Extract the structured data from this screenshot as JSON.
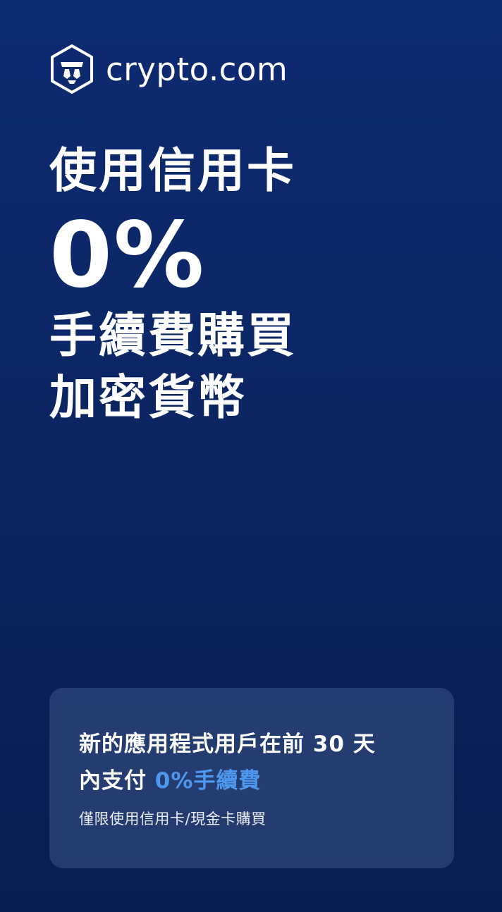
{
  "brand": {
    "name": "crypto.com",
    "icon": "crypto-com-lion-shield-icon"
  },
  "headline": {
    "line1": "使用信用卡",
    "big": "0%",
    "line2": "手續費購買",
    "line3": "加密貨幣"
  },
  "promo": {
    "title_line1": "新的應用程式用戶在前 30 天",
    "title_line2_prefix": "內支付 ",
    "title_highlight": "0%手續費",
    "note": "僅限使用信用卡/現金卡購買"
  },
  "colors": {
    "background_top": "#0d2b72",
    "background_bottom": "#0a1d52",
    "highlight": "#4d98ee",
    "card": "#2b4372"
  }
}
